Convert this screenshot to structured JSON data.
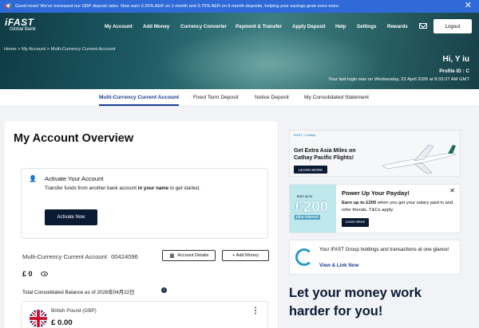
{
  "announcement": {
    "text": "Good news! We've increased our GBP deposit rates. Now earn 3.25% AER on 1-month and 3.70% AER on 6-month deposits, helping your savings grow even more.",
    "speaker_icon": "speaker-icon",
    "close_icon": "close-icon"
  },
  "header": {
    "logo_main": "iFAST",
    "logo_sub": "Global Bank",
    "nav": [
      "My Account",
      "Add Money",
      "Currency Converter",
      "Payment & Transfer",
      "Apply Deposit",
      "Help",
      "Settings",
      "Rewards"
    ],
    "mail_icon": "mail-icon",
    "logout": "Logout",
    "breadcrumb": "Home > My Account > Multi-Currency Current Account",
    "greeting": "Hi, Y        iu",
    "profile_id": "Profile ID : C",
    "last_login": "Your last login was on Wednesday, 22 April 2026 at 8:33:27 AM GMT"
  },
  "tabs": [
    "Multi-Currency Current Account",
    "Fixed Term Deposit",
    "Notice Deposit",
    "My Consolidated Statement"
  ],
  "active_tab": "Multi-Currency Current Account",
  "overview": {
    "title": "My Account Overview",
    "activate_title": "Activate Your Account",
    "activate_text_1": "Transfer funds from another bank account ",
    "activate_text_bold": "in your name",
    "activate_text_2": " to get started.",
    "activate_button": "Activate Now",
    "account_name": "Multi-Currency Current Account",
    "account_number": "00424096",
    "account_details_button": "Account Details",
    "add_money_button": "+ Add Money",
    "balance": "£ 0",
    "total_label": "Total Consolidated Balance as of 2026年04月22日",
    "currency_name": "British Pound (GBP)",
    "currency_amount": "£ 0.00"
  },
  "ads": {
    "cathay_logo": "iFAST × cathay",
    "cathay_text": "Get Extra Asia Miles on Cathay Pacific Flights!",
    "cathay_button": "LEARN MORE",
    "payday_earn_up_to": "Earn up to",
    "payday_amount": "£200",
    "payday_plus_interest": "plus interest",
    "payday_title": "Power Up Your Payday!",
    "payday_text_bold": "Earn up to £200",
    "payday_text": " when you get your salary paid in and refer friends. T&Cs apply.",
    "payday_button": "Learn More",
    "group_text": "Your iFAST Group holdings and transactions at one glance!",
    "group_link": "View & Link Now",
    "promo_line1": "Let your money work",
    "promo_line2": "harder for you!"
  },
  "colors": {
    "announce_bg": "#2f6ad8",
    "accent": "#1b3d94",
    "dark_button": "#0b1a33",
    "hero": "#1d5a63"
  }
}
